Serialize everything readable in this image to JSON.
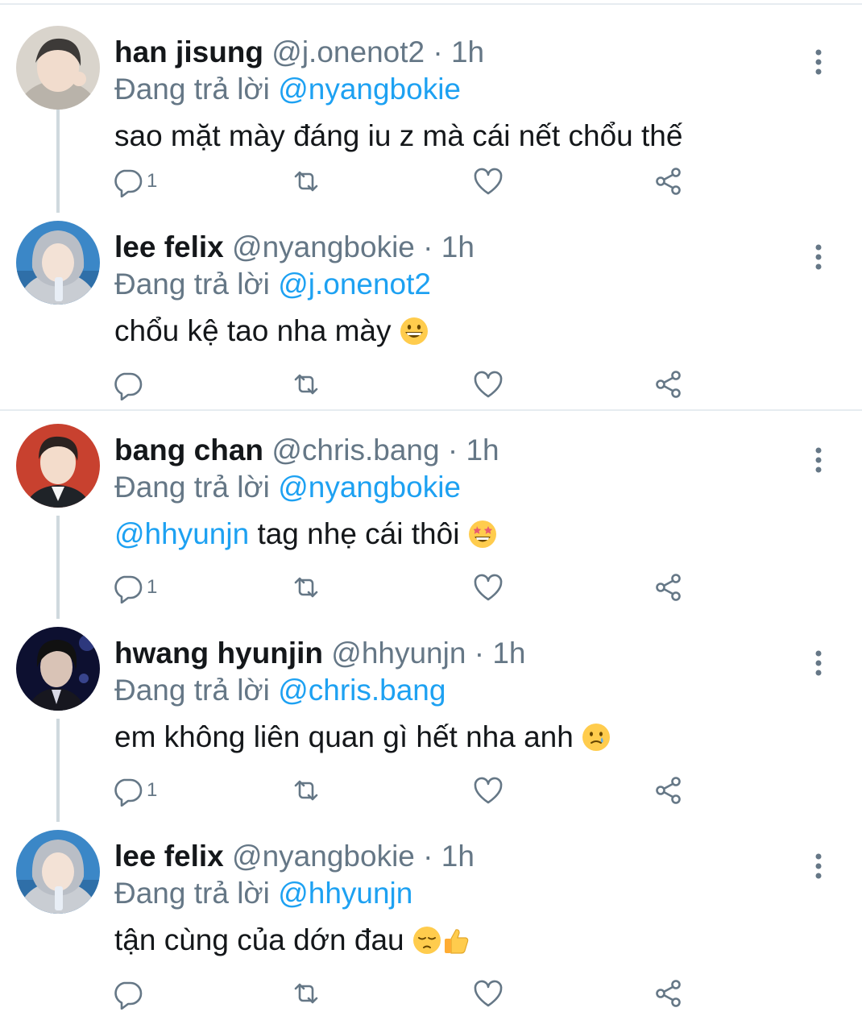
{
  "reply_prefix": "Đang trả lời",
  "tweets": [
    {
      "name": "han jisung",
      "handle": "@j.onenot2",
      "dot": "·",
      "time": "1h",
      "reply_to": "@nyangbokie",
      "text_mention": "",
      "text": "sao mặt mày đáng iu z mà cái nết chổu thế",
      "emoji": [],
      "reply_count": "1"
    },
    {
      "name": "lee felix",
      "handle": "@nyangbokie",
      "dot": "·",
      "time": "1h",
      "reply_to": "@j.onenot2",
      "text_mention": "",
      "text": "chổu kệ tao nha mày ",
      "emoji": [
        "grinning-face-emoji"
      ],
      "reply_count": ""
    },
    {
      "name": "bang chan",
      "handle": "@chris.bang",
      "dot": "·",
      "time": "1h",
      "reply_to": "@nyangbokie",
      "text_mention": "@hhyunjn",
      "text": " tag nhẹ cái thôi ",
      "emoji": [
        "star-struck-emoji"
      ],
      "reply_count": "1"
    },
    {
      "name": "hwang hyunjin",
      "handle": "@hhyunjn",
      "dot": "·",
      "time": "1h",
      "reply_to": "@chris.bang",
      "text_mention": "",
      "text": "em không liên quan gì hết nha anh ",
      "emoji": [
        "tear-smile-emoji"
      ],
      "reply_count": "1"
    },
    {
      "name": "lee felix",
      "handle": "@nyangbokie",
      "dot": "·",
      "time": "1h",
      "reply_to": "@hhyunjn",
      "text_mention": "",
      "text": "tận cùng của dớn đau ",
      "emoji": [
        "pensive-face-emoji",
        "thumbs-up-emoji"
      ],
      "reply_count": ""
    }
  ],
  "colors": {
    "link": "#1da1f2",
    "muted": "#657786",
    "text": "#14171a",
    "divider": "#e6ecf0",
    "thread_line": "#cfd9de"
  },
  "icons": [
    "reply-icon",
    "retweet-icon",
    "like-icon",
    "share-icon",
    "more-options-icon"
  ]
}
